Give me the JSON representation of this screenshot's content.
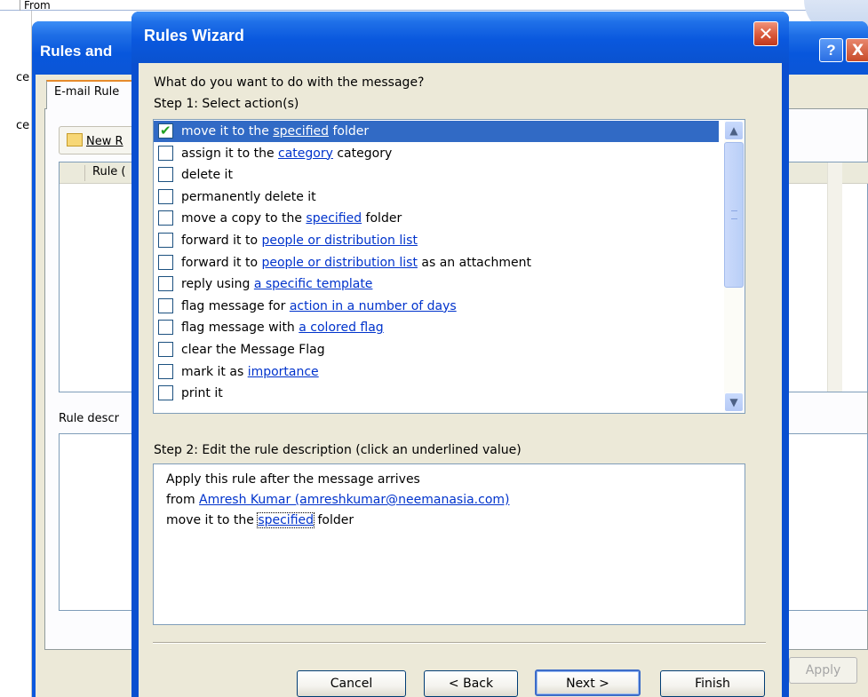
{
  "background": {
    "from_column": "From",
    "left_marks": [
      "ce",
      "ce"
    ]
  },
  "rules_dialog": {
    "title": "Rules and",
    "help_glyph": "?",
    "close_glyph": "X",
    "tab_label": "E-mail Rule",
    "new_rule_label": "New R",
    "rule_column": "Rule (",
    "rule_description_label": "Rule descr",
    "apply_label": "Apply"
  },
  "wizard": {
    "title": "Rules Wizard",
    "close_glyph": "✕",
    "question": "What do you want to do with the message?",
    "step1_label": "Step 1: Select action(s)",
    "actions": [
      {
        "before": "move it to the ",
        "link": "specified",
        "after": " folder",
        "checked": true,
        "selected": true
      },
      {
        "before": "assign it to the ",
        "link": "category",
        "after": " category",
        "checked": false,
        "selected": false
      },
      {
        "before": "delete it",
        "link": "",
        "after": "",
        "checked": false,
        "selected": false
      },
      {
        "before": "permanently delete it",
        "link": "",
        "after": "",
        "checked": false,
        "selected": false
      },
      {
        "before": "move a copy to the ",
        "link": "specified",
        "after": " folder",
        "checked": false,
        "selected": false
      },
      {
        "before": "forward it to ",
        "link": "people or distribution list",
        "after": "",
        "checked": false,
        "selected": false
      },
      {
        "before": "forward it to ",
        "link": "people or distribution list",
        "after": " as an attachment",
        "checked": false,
        "selected": false
      },
      {
        "before": "reply using ",
        "link": "a specific template",
        "after": "",
        "checked": false,
        "selected": false
      },
      {
        "before": "flag message for ",
        "link": "action in a number of days",
        "after": "",
        "checked": false,
        "selected": false
      },
      {
        "before": "flag message with ",
        "link": "a colored flag",
        "after": "",
        "checked": false,
        "selected": false
      },
      {
        "before": "clear the Message Flag",
        "link": "",
        "after": "",
        "checked": false,
        "selected": false
      },
      {
        "before": "mark it as ",
        "link": "importance",
        "after": "",
        "checked": false,
        "selected": false
      },
      {
        "before": "print it",
        "link": "",
        "after": "",
        "checked": false,
        "selected": false
      }
    ],
    "step2_label": "Step 2: Edit the rule description (click an underlined value)",
    "description": {
      "line1": "Apply this rule after the message arrives",
      "line2_prefix": "from ",
      "line2_link": "Amresh Kumar (amreshkumar@neemanasia.com)",
      "line3_prefix": "move it to the ",
      "line3_link": "specified",
      "line3_suffix": " folder"
    },
    "buttons": {
      "cancel": "Cancel",
      "back": "< Back",
      "next": "Next >",
      "finish": "Finish"
    },
    "scroll": {
      "up": "▲",
      "down": "▼"
    }
  },
  "colors": {
    "titlebar_blue": "#0a58de",
    "selection": "#316ac5",
    "link": "#0033cc",
    "dialog_face": "#ece9d8"
  }
}
